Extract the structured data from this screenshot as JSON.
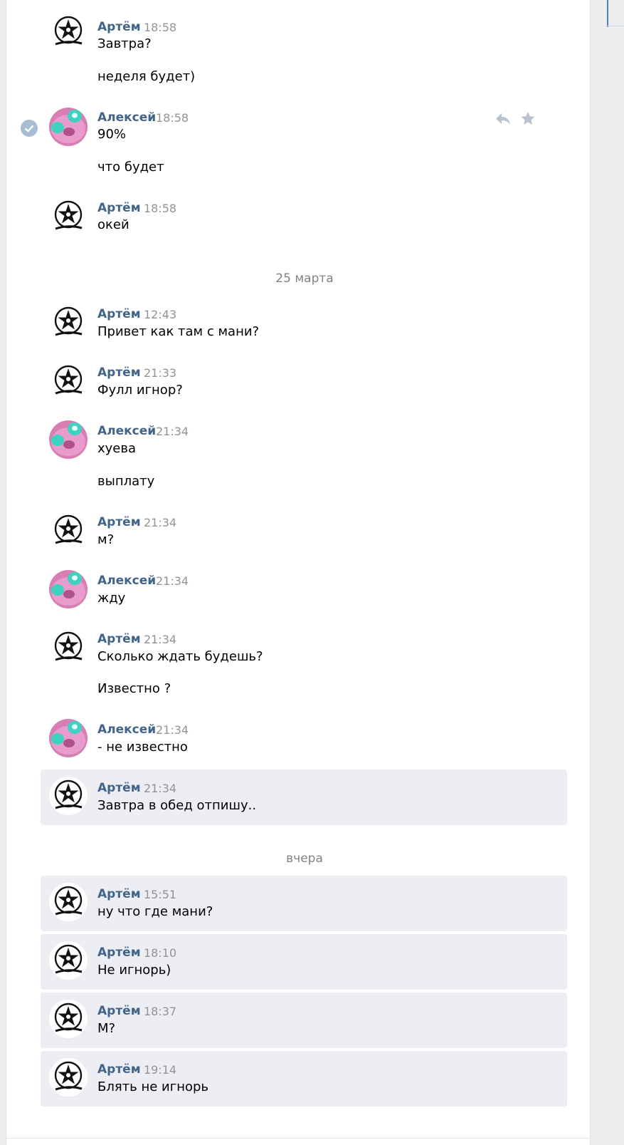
{
  "colors": {
    "author": "#42648b",
    "time": "#939393",
    "highlight": "#edeef3",
    "background": "#edeef0"
  },
  "icons": [
    "check-circle-icon",
    "reply-icon",
    "star-icon",
    "wolf-star-avatar",
    "pink-avatar"
  ],
  "date_separators": [
    "25 марта",
    "вчера"
  ],
  "messages": [
    {
      "author": "Артём",
      "time": "18:58",
      "lines": [
        "Завтра?",
        "неделя будет)"
      ]
    },
    {
      "author": "Алексей",
      "time": "18:58",
      "lines": [
        "90%",
        "что будет"
      ]
    },
    {
      "author": "Артём",
      "time": "18:58",
      "lines": [
        "окей"
      ]
    },
    {
      "author": "Артём",
      "time": "12:43",
      "lines": [
        "Привет как там с мани?"
      ]
    },
    {
      "author": "Артём",
      "time": "21:33",
      "lines": [
        "Фулл игнор?"
      ]
    },
    {
      "author": "Алексей",
      "time": "21:34",
      "lines": [
        "хуева",
        "выплату"
      ]
    },
    {
      "author": "Артём",
      "time": "21:34",
      "lines": [
        "м?"
      ]
    },
    {
      "author": "Алексей",
      "time": "21:34",
      "lines": [
        "жду"
      ]
    },
    {
      "author": "Артём",
      "time": "21:34",
      "lines": [
        "Сколько ждать будешь?",
        "Известно ?"
      ]
    },
    {
      "author": "Алексей",
      "time": "21:34",
      "lines": [
        "- не известно"
      ]
    },
    {
      "author": "Артём",
      "time": "21:34",
      "lines": [
        "Завтра в обед отпишу.."
      ]
    },
    {
      "author": "Артём",
      "time": "15:51",
      "lines": [
        "ну что где мани?"
      ]
    },
    {
      "author": "Артём",
      "time": "18:10",
      "lines": [
        "Не игнорь)"
      ]
    },
    {
      "author": "Артём",
      "time": "18:37",
      "lines": [
        "М?"
      ]
    },
    {
      "author": "Артём",
      "time": "19:14",
      "lines": [
        "Блять не игнорь"
      ]
    }
  ]
}
